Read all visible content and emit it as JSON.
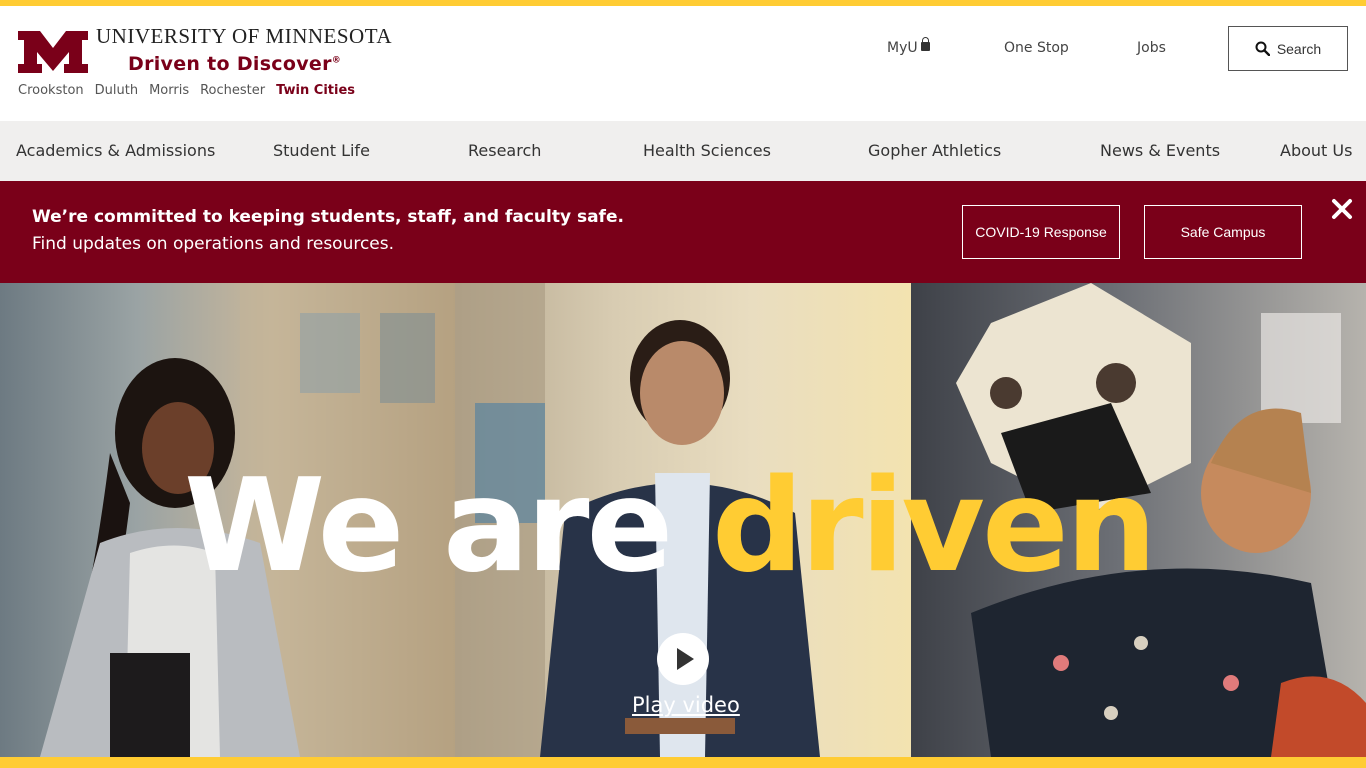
{
  "header": {
    "wordmark": "UNIVERSITY OF MINNESOTA",
    "tagline": "Driven to Discover",
    "tagline_mark": "®",
    "campuses": [
      "Crookston",
      "Duluth",
      "Morris",
      "Rochester",
      "Twin Cities"
    ],
    "active_campus": "Twin Cities",
    "util_links": [
      "MyU",
      "One Stop",
      "Jobs"
    ],
    "search_label": "Search"
  },
  "nav": {
    "items": [
      "Academics & Admissions",
      "Student Life",
      "Research",
      "Health Sciences",
      "Gopher Athletics",
      "News & Events",
      "About Us"
    ]
  },
  "alert": {
    "headline": "We’re committed to keeping students, staff, and faculty safe.",
    "subtext": "Find updates on operations and resources.",
    "buttons": [
      "COVID-19 Response",
      "Safe Campus"
    ]
  },
  "hero": {
    "headline_part1": "We are",
    "headline_part2": "driven",
    "play_label": "Play video"
  },
  "colors": {
    "maroon": "#7a0019",
    "gold": "#ffcc33",
    "nav_bg": "#f0efee"
  },
  "icons": {
    "lock": "lock-icon",
    "search": "search-icon",
    "close": "close-icon",
    "play": "play-icon"
  }
}
